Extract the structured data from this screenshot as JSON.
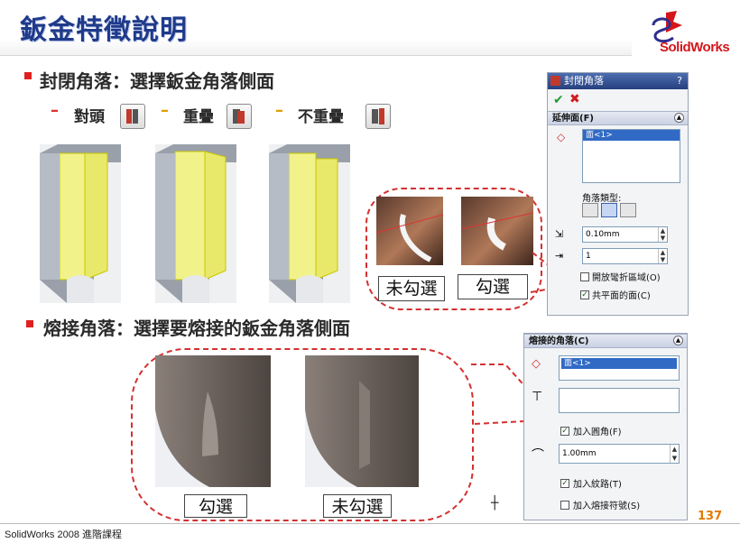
{
  "slide": {
    "title": "鈑金特徵說明",
    "logo_text": "SolidWorks",
    "footer": "SolidWorks 2008 進階課程",
    "page_number": "137"
  },
  "closed_corner": {
    "heading": "封閉角落：選擇鈑金角落側面",
    "types": [
      "對頭",
      "重疊",
      "不重疊"
    ],
    "captions": [
      "未勾選",
      "勾選"
    ]
  },
  "weld_corner": {
    "heading": "熔接角落：選擇要熔接的鈑金角落側面",
    "captions": [
      "勾選",
      "未勾選"
    ]
  },
  "pm_closed": {
    "title": "封閉角落",
    "help": "?",
    "section": "延伸面(F)",
    "list_item": "面<1>",
    "corner_type_label": "角落類型:",
    "gap_value": "0.10mm",
    "ratio_value": "1",
    "options": [
      {
        "label": "開放彎折區域(O)",
        "checked": false
      },
      {
        "label": "共平面的面(C)",
        "checked": true
      }
    ]
  },
  "pm_weld": {
    "section": "熔接的角落(C)",
    "list_item": "面<1>",
    "add_fillet": {
      "label": "加入圓角(F)",
      "checked": true
    },
    "radius_value": "1.00mm",
    "add_texture": {
      "label": "加入紋路(T)",
      "checked": true
    },
    "add_weld_symbol": {
      "label": "加入熔接符號(S)",
      "checked": false
    }
  },
  "colors": {
    "title": "#1f3a8a",
    "accent": "#d43030",
    "page_number": "#e07a00"
  }
}
